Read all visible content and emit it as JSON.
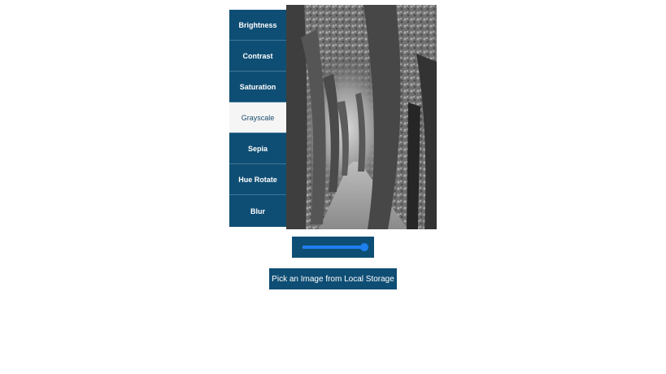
{
  "filters": {
    "items": [
      {
        "label": "Brightness",
        "active": false
      },
      {
        "label": "Contrast",
        "active": false
      },
      {
        "label": "Saturation",
        "active": false
      },
      {
        "label": "Grayscale",
        "active": true
      },
      {
        "label": "Sepia",
        "active": false
      },
      {
        "label": "Hue Rotate",
        "active": false
      },
      {
        "label": "Blur",
        "active": false
      }
    ]
  },
  "slider": {
    "value_fraction": 1.0
  },
  "pick_button": {
    "label": "Pick an Image from Local Storage"
  },
  "colors": {
    "accent": "#0f4e74",
    "active_background": "#f5f5f5",
    "slider": "#1e7ff0"
  }
}
